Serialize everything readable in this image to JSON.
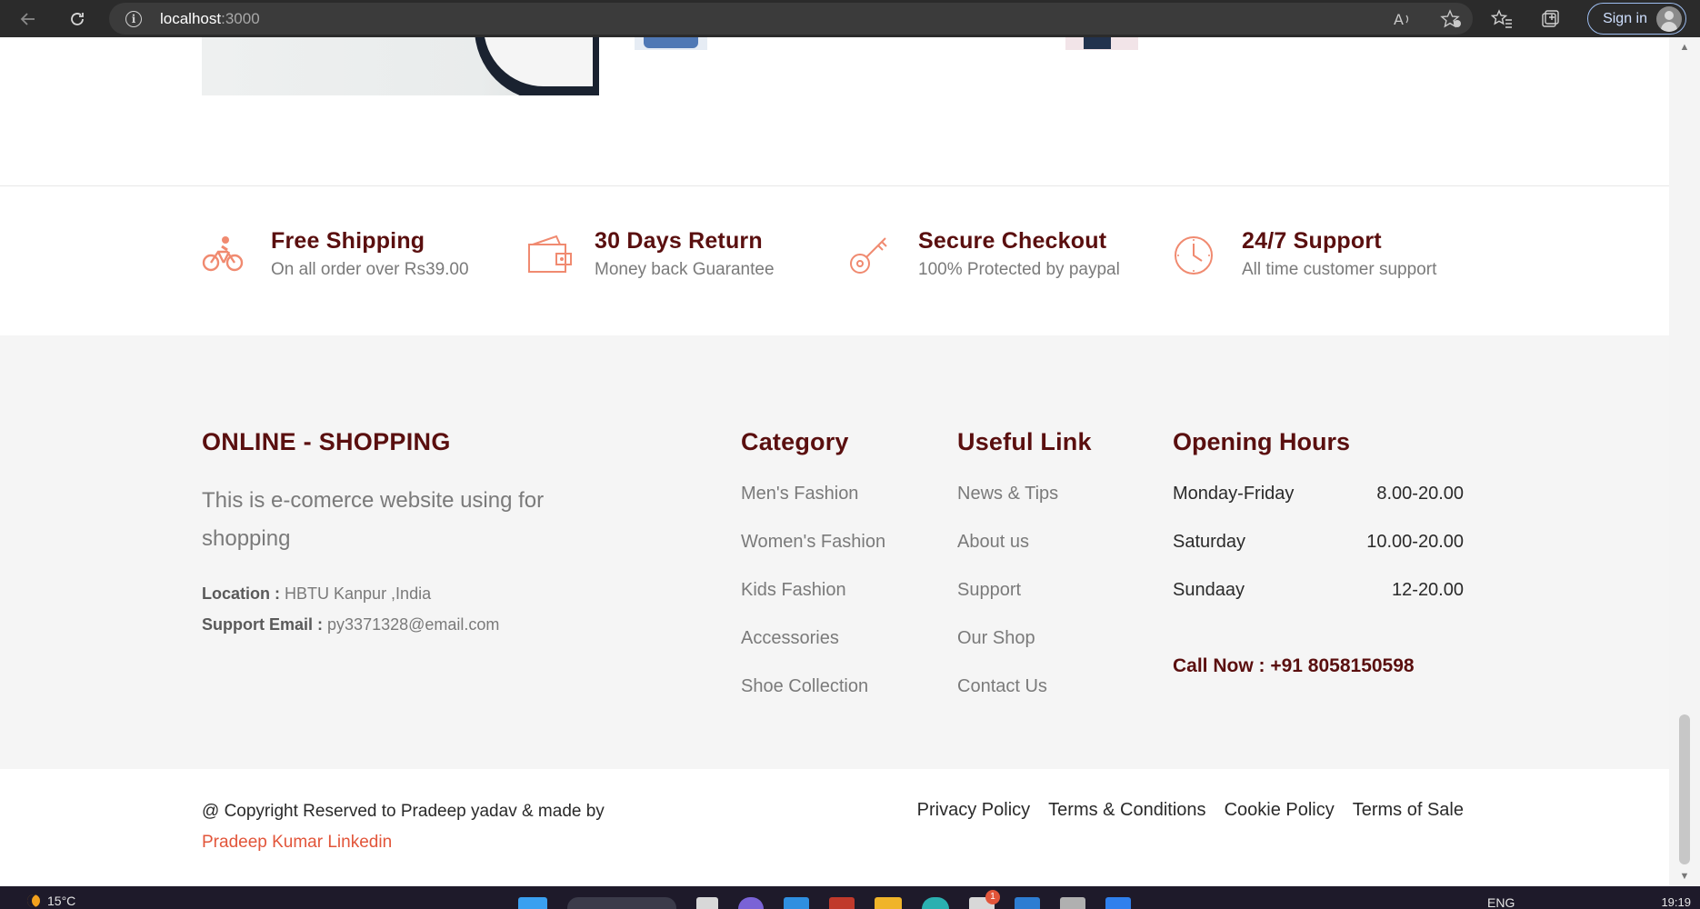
{
  "browser": {
    "url_host": "localhost",
    "url_port": ":3000",
    "sign_in": "Sign in"
  },
  "features": [
    {
      "title": "Free Shipping",
      "subtitle": "On all order over Rs39.00",
      "icon": "bicycle-icon"
    },
    {
      "title": "30 Days Return",
      "subtitle": "Money back Guarantee",
      "icon": "wallet-icon"
    },
    {
      "title": "Secure Checkout",
      "subtitle": "100% Protected by paypal",
      "icon": "key-icon"
    },
    {
      "title": "24/7 Support",
      "subtitle": "All time customer support",
      "icon": "clock-icon"
    }
  ],
  "footer": {
    "brand": "ONLINE - SHOPPING",
    "description": "This is e-comerce website using for shopping",
    "location_label": "Location :",
    "location_value": "HBTU Kanpur ,India",
    "email_label": "Support Email :",
    "email_value": "py3371328@email.com",
    "category": {
      "title": "Category",
      "items": [
        "Men's Fashion",
        "Women's Fashion",
        "Kids Fashion",
        "Accessories",
        "Shoe Collection"
      ]
    },
    "useful": {
      "title": "Useful Link",
      "items": [
        "News & Tips",
        "About us",
        "Support",
        "Our Shop",
        "Contact Us"
      ]
    },
    "hours": {
      "title": "Opening Hours",
      "rows": [
        {
          "day": "Monday-Friday",
          "time": "8.00-20.00"
        },
        {
          "day": "Saturday",
          "time": "10.00-20.00"
        },
        {
          "day": "Sundaay",
          "time": "12-20.00"
        }
      ],
      "call": "Call Now : +91 8058150598"
    }
  },
  "bottom": {
    "copyright": "@ Copyright Reserved to Pradeep yadav & made by",
    "author_link": "Pradeep Kumar Linkedin",
    "legal": [
      "Privacy Policy",
      "Terms & Conditions",
      "Cookie Policy",
      "Terms of Sale"
    ]
  },
  "taskbar": {
    "temperature": "15°C",
    "language": "ENG",
    "time": "19:19",
    "notification_count": "1"
  },
  "colors": {
    "accent": "#e2553a",
    "heading": "#5a0f0f",
    "icon": "#f08a70"
  }
}
